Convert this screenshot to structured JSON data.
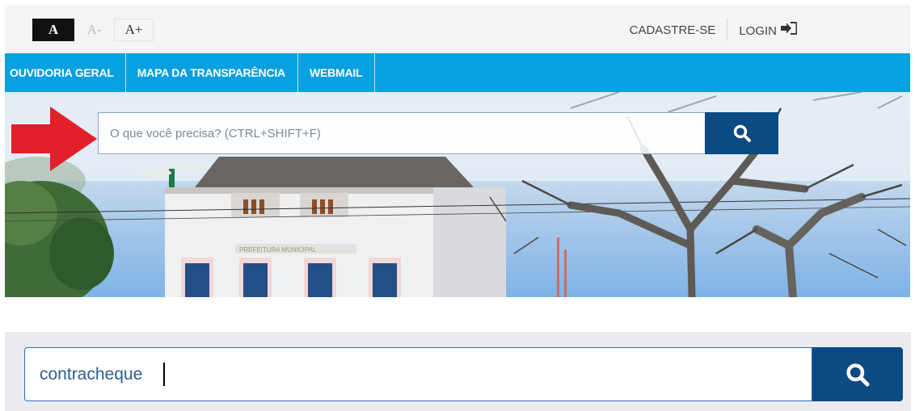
{
  "font_size_controls": {
    "normal": "A",
    "decrease": "A-",
    "increase": "A+"
  },
  "account": {
    "register": "CADASTRE-SE",
    "login": "LOGIN"
  },
  "nav": {
    "items": [
      "OUVIDORIA GERAL",
      "MAPA DA TRANSPARÊNCIA",
      "WEBMAIL"
    ]
  },
  "hero": {
    "building_sign": "PREFEITURA MUNICIPAL"
  },
  "search_top": {
    "placeholder": "O que você precisa? (CTRL+SHIFT+F)"
  },
  "search_bottom": {
    "value": "contracheque"
  },
  "colors": {
    "nav_bar": "#07a0e0",
    "search_button": "#0b4a82",
    "arrow": "#e3202a"
  }
}
